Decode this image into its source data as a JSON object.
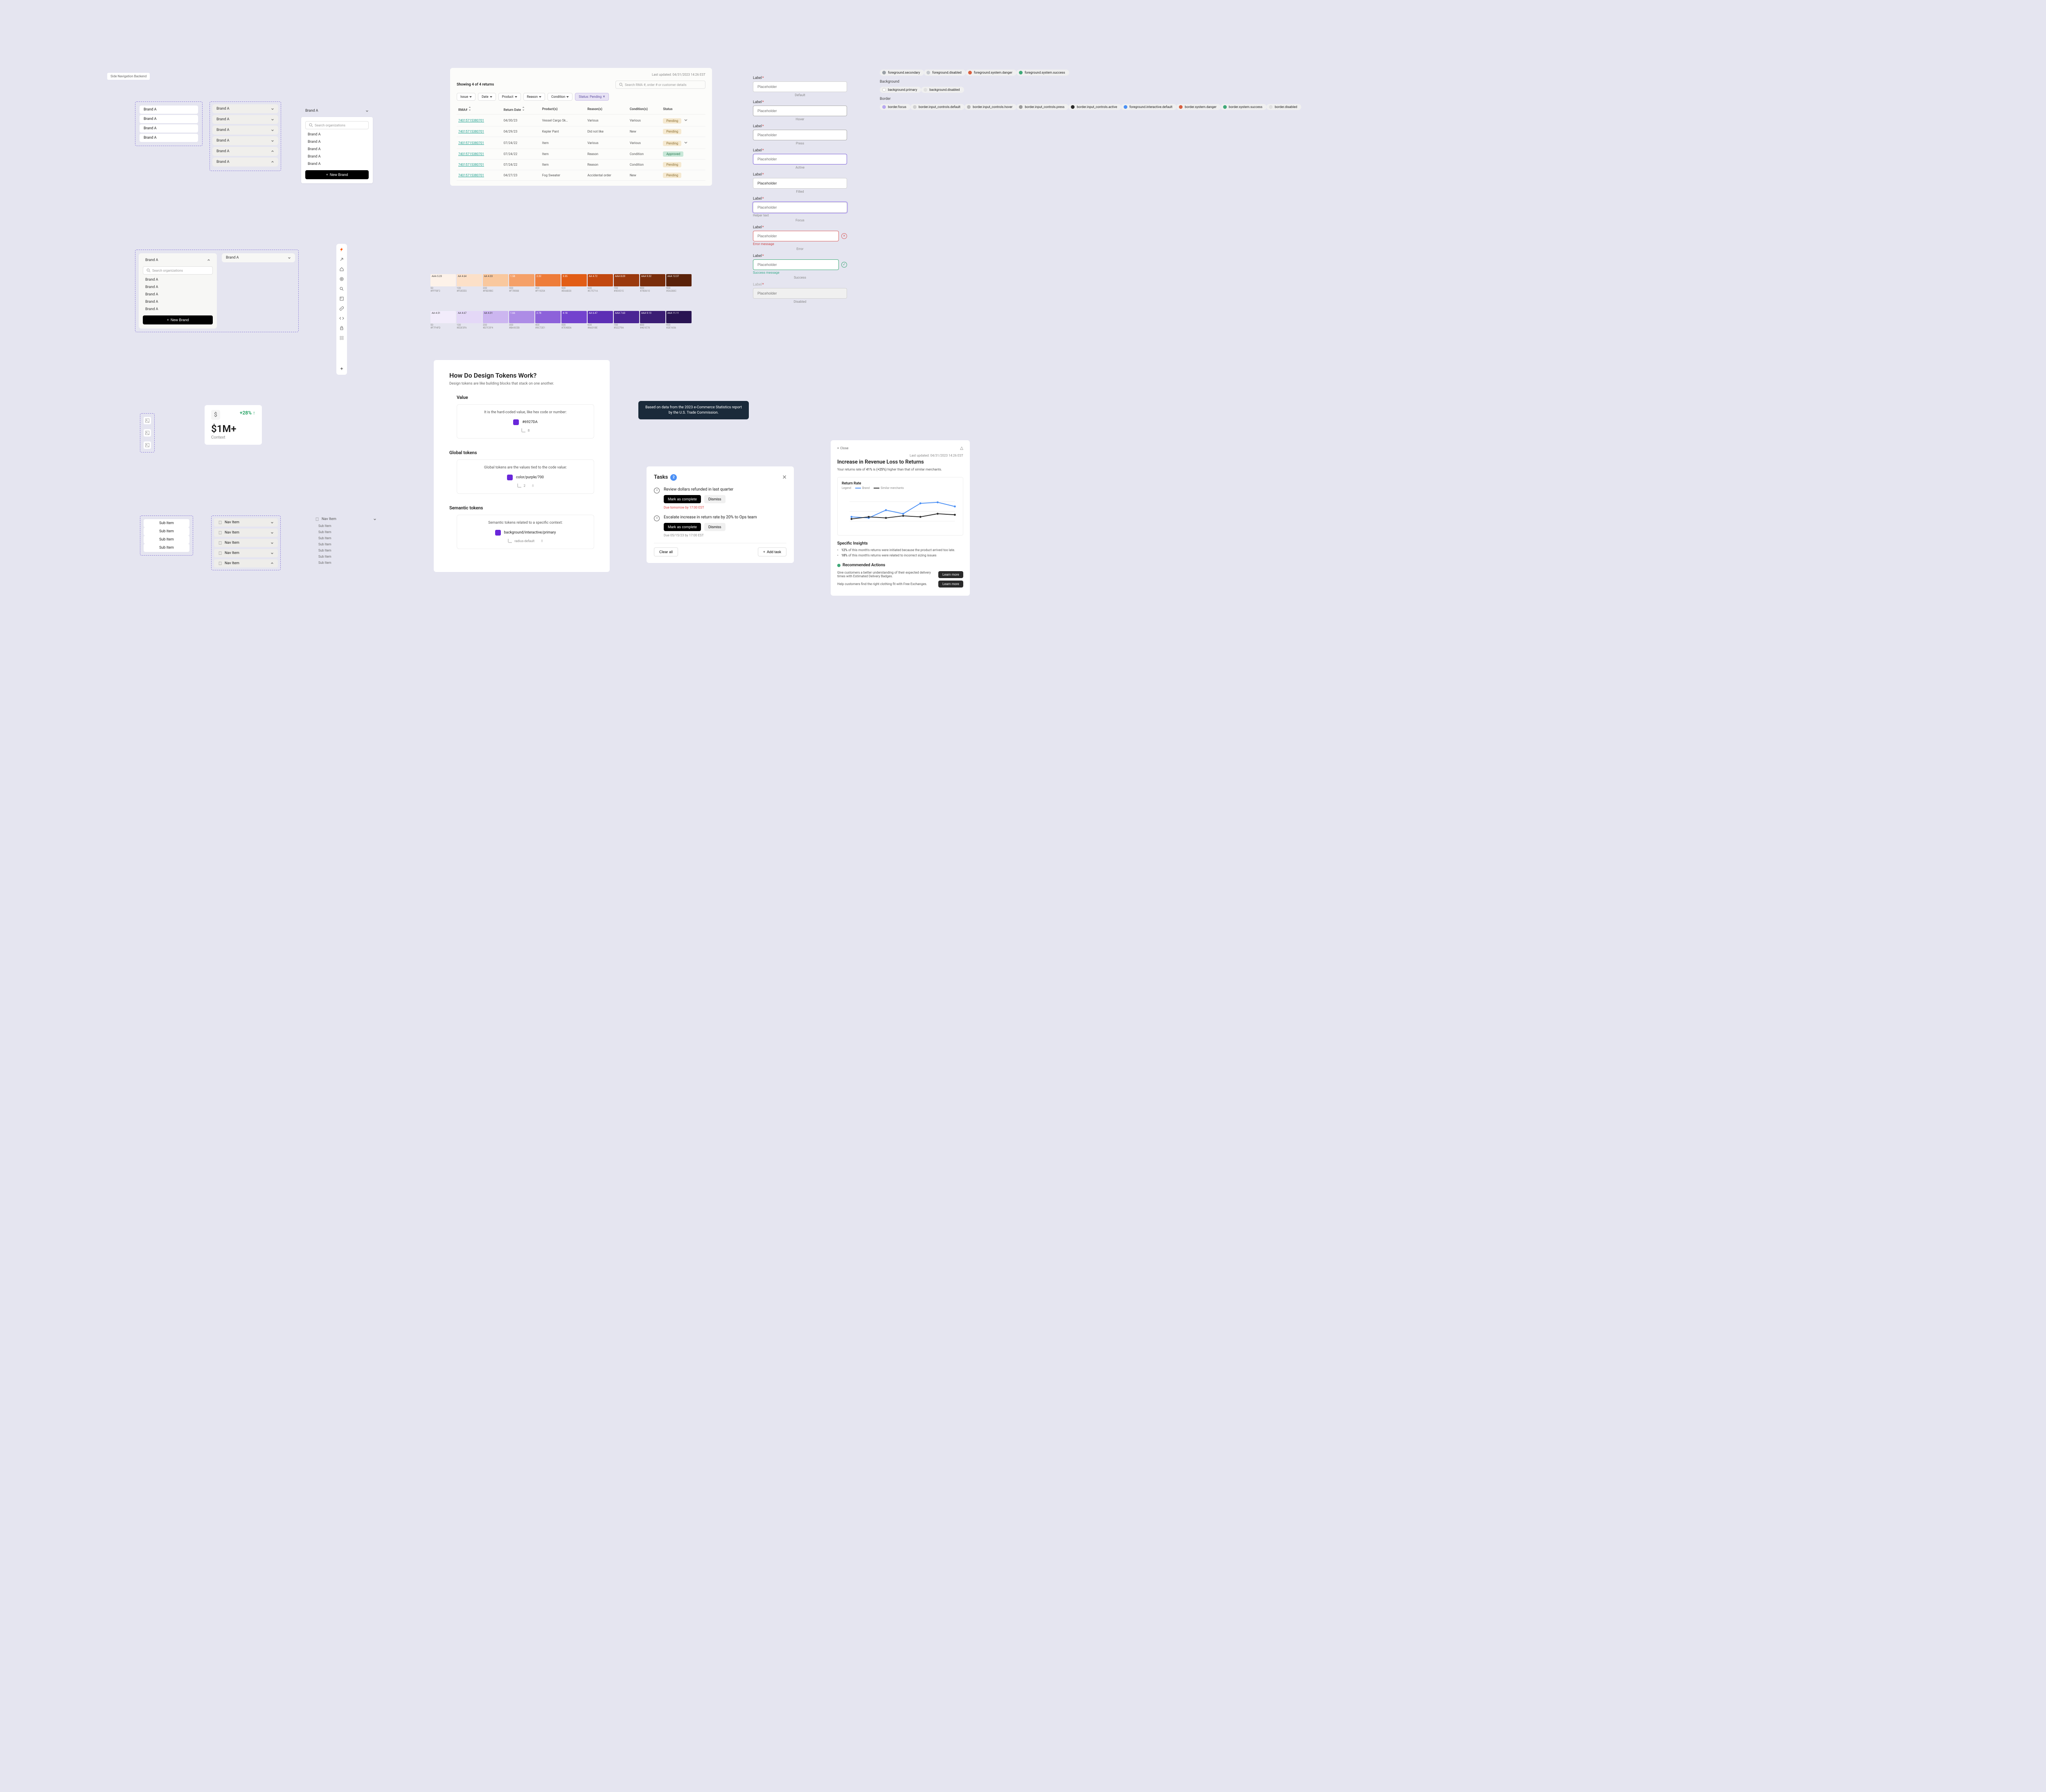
{
  "tiny_label": "Side Navigation Backend",
  "brand_box_1": {
    "items": [
      "Brand A",
      "Brand A",
      "Brand A",
      "Brand A"
    ]
  },
  "brand_box_2": {
    "items": [
      "Brand A",
      "Brand A",
      "Brand A",
      "Brand A",
      "Brand A",
      "Brand A"
    ]
  },
  "brand_box_3": {
    "header": "Brand A",
    "search_placeholder": "Search organizations",
    "items": [
      "Brand A",
      "Brand A",
      "Brand A",
      "Brand A",
      "Brand A"
    ],
    "new_brand": "New Brand"
  },
  "brand_box_4": {
    "open_header": "Brand A",
    "closed_header": "Brand A",
    "search_placeholder": "Search organizations",
    "items": [
      "Brand A",
      "Brand A",
      "Brand A",
      "Brand A",
      "Brand A"
    ],
    "new_brand": "New Brand"
  },
  "stat": {
    "pct": "+28%",
    "pct_arrow": "↑",
    "currency": "$",
    "big": "$1M+",
    "context": "Context"
  },
  "sub_items_1": {
    "items": [
      "Sub Item",
      "Sub Item",
      "Sub Item",
      "Sub Item"
    ]
  },
  "nav_items_mid": {
    "items": [
      "Nav Item",
      "Nav Item",
      "Nav Item",
      "Nav Item",
      "Nav Item"
    ]
  },
  "nav_items_right": {
    "header": "Nav Item",
    "subs": [
      "Sub Item",
      "Sub Item",
      "Sub Item",
      "Sub Item",
      "Sub Item",
      "Sub Item",
      "Sub Item"
    ]
  },
  "returns": {
    "showing": "Showing 4 of 4 returns",
    "last_updated": "Last updated: 04/31/2023 14:26 EST",
    "search_placeholder": "Search RMA #, order # or customer details",
    "filters": {
      "issue": "Issue",
      "date": "Date",
      "product": "Product",
      "reason": "Reason",
      "condition": "Condition",
      "status_active": "Status: Pending"
    },
    "headers": [
      "RMA#",
      "Return Date",
      "Product(s)",
      "Reason(s)",
      "Condition(s)",
      "Status"
    ],
    "rows": [
      {
        "rma": "74015715380701",
        "date": "04/30/23",
        "product": "Vessel Cargo Sk…",
        "reason": "Various",
        "cond": "Various",
        "status": "Pending",
        "approved": false,
        "chev": true
      },
      {
        "rma": "74015715380701",
        "date": "04/29/23",
        "product": "Kepler Pant",
        "reason": "Did not like",
        "cond": "New",
        "status": "Pending",
        "approved": false
      },
      {
        "rma": "74015715380701",
        "date": "07/24/22",
        "product": "Item",
        "reason": "Various",
        "cond": "Various",
        "status": "Pending",
        "approved": false,
        "chev": true
      },
      {
        "rma": "74015715380701",
        "date": "07/24/22",
        "product": "Item",
        "reason": "Reason",
        "cond": "Condition",
        "status": "Approved",
        "approved": true
      },
      {
        "rma": "74015715380701",
        "date": "07/24/22",
        "product": "Item",
        "reason": "Reason",
        "cond": "Condition",
        "status": "Pending",
        "approved": false
      },
      {
        "rma": "74015715380701",
        "date": "04/27/23",
        "product": "Fog Sweater",
        "reason": "Accidental order",
        "cond": "New",
        "status": "Pending",
        "approved": false
      }
    ]
  },
  "ramp_orange": {
    "swatches": [
      {
        "name": "AAA 5.23",
        "bg": "#fdf2e9",
        "fg": "#333"
      },
      {
        "name": "AA 4.64",
        "bg": "#fce0c8",
        "fg": "#333"
      },
      {
        "name": "AA 4.33",
        "bg": "#f9c89e",
        "fg": "#333"
      },
      {
        "name": "1.58",
        "bg": "#f5a068",
        "fg": "#fff"
      },
      {
        "name": "2.32",
        "bg": "#ee7c3a",
        "fg": "#fff"
      },
      {
        "name": "3.35",
        "bg": "#e25d16",
        "fg": "#fff"
      },
      {
        "name": "AA 4.72",
        "bg": "#c24810",
        "fg": "#fff"
      },
      {
        "name": "AAA 8.09",
        "bg": "#9a390e",
        "fg": "#fff"
      },
      {
        "name": "AAA 9.32",
        "bg": "#7a2e0c",
        "fg": "#fff"
      },
      {
        "name": "AAA 12.37",
        "bg": "#5a220a",
        "fg": "#fff"
      }
    ],
    "sublabels": [
      "50\n#FFF8F2",
      "100\n#FDEEE0",
      "200\n#FBD9BC",
      "300\n#F7B988",
      "400\n#F19254",
      "500\n#E66B20",
      "600\n#C7571A",
      "700\n#9E4515",
      "800\n#7B3610",
      "900\n#5A280C"
    ]
  },
  "ramp_purple": {
    "swatches": [
      {
        "name": "AA 4.51",
        "bg": "#f2ecfb",
        "fg": "#333"
      },
      {
        "name": "AA 4.67",
        "bg": "#e4d8f7",
        "fg": "#333"
      },
      {
        "name": "AA 4.31",
        "bg": "#ccb6f0",
        "fg": "#333"
      },
      {
        "name": "1.66",
        "bg": "#ad8ce6",
        "fg": "#fff"
      },
      {
        "name": "2.78",
        "bg": "#8d62da",
        "fg": "#fff"
      },
      {
        "name": "4.18",
        "bg": "#7343ce",
        "fg": "#fff"
      },
      {
        "name": "AA 6.47",
        "bg": "#5d2fb5",
        "fg": "#fff"
      },
      {
        "name": "AAA 7.63",
        "bg": "#4b2594",
        "fg": "#fff"
      },
      {
        "name": "AAA 9.13",
        "bg": "#3b1d74",
        "fg": "#fff"
      },
      {
        "name": "AAA 11.11",
        "bg": "#291452",
        "fg": "#fff"
      }
    ],
    "sublabels": [
      "50\n#F7F4FD",
      "100\n#EDE5FA",
      "200\n#D7C5F4",
      "300\n#BA9CEB",
      "400\n#9C72E1",
      "500\n#7E48D6",
      "600\n#6631BE",
      "700\n#52279A",
      "800\n#401E78",
      "900\n#2E1656"
    ]
  },
  "tokens": {
    "title": "How Do Design Tokens Work?",
    "subtitle": "Design tokens are like building blocks that stack on one another.",
    "value": {
      "h": "Value",
      "desc": "It is the hard-coded value, like hex code or number:",
      "hex": "#6927DA",
      "num": "8"
    },
    "global": {
      "h": "Global tokens",
      "desc": "Global tokens are the values tied to the code value:",
      "name": "color/purple/700",
      "step": "2",
      "sub": "8"
    },
    "semantic": {
      "h": "Semantic tokens",
      "desc": "Semantic tokens related to a specific context:",
      "name": "background/interactive/primary",
      "sub": "radius-default",
      "subnum": "8"
    }
  },
  "tooltip": "Based on data from the 2023 e-Commerce Statistics report by the U.S. Trade Commission.",
  "inputs": {
    "label": "Label",
    "req": "*",
    "ph": "Placeholder",
    "states": [
      "Default",
      "Hover",
      "Press",
      "Active",
      "Filled",
      "Focus",
      "Error",
      "Success",
      "Disabled"
    ],
    "helper": "Helper text",
    "error_msg": "Error message",
    "success_msg": "Success message"
  },
  "chips": {
    "foreground": [
      {
        "c": "#9aa0a6",
        "t": "foreground.secondary"
      },
      {
        "c": "#c4c7cc",
        "t": "foreground.disabled"
      },
      {
        "c": "#d85f3f",
        "t": "foreground.system.danger"
      },
      {
        "c": "#3fa878",
        "t": "foreground.system.success"
      }
    ],
    "background_h": "Background",
    "background": [
      {
        "c": "#ffffff",
        "t": "background.primary",
        "border": true
      },
      {
        "c": "#e0e0e0",
        "t": "background.disabled"
      }
    ],
    "border_h": "Border",
    "border": [
      {
        "c": "#b8a8f0",
        "t": "border.focus"
      },
      {
        "c": "#d0d0d0",
        "t": "border.input_controls.default"
      },
      {
        "c": "#b8b8b8",
        "t": "border.input_controls.hover"
      },
      {
        "c": "#9a9a9a",
        "t": "border.input_controls.press"
      },
      {
        "c": "#2a2a2a",
        "t": "border.input_controls.active"
      },
      {
        "c": "#4a8ff5",
        "t": "foreground.interactive.default"
      },
      {
        "c": "#d85f3f",
        "t": "border.system.danger"
      },
      {
        "c": "#3fa878",
        "t": "border.system.success"
      },
      {
        "c": "#e0e0e0",
        "t": "border.disabled"
      }
    ]
  },
  "tasks": {
    "title": "Tasks",
    "count": "2",
    "close": "×",
    "items": [
      {
        "title": "Review dollars refunded in last quarter",
        "complete": "Mark as complete",
        "dismiss": "Dismiss",
        "due": "Due tomorrow by 17:00 EST",
        "due_red": true
      },
      {
        "title": "Escalate increase in return rate by 20% to Ops team",
        "complete": "Mark as complete",
        "dismiss": "Dismiss",
        "due": "Due 05/15/23 by 17:00 EST",
        "due_red": false
      }
    ],
    "clear": "Clear all",
    "add": "Add task"
  },
  "insight": {
    "close": "Close",
    "updated": "Last updated: 04/31/2023 14:26 EST",
    "title": "Increase in Revenue Loss to Returns",
    "sub_pre": "Your returns rate of",
    "sub_bold": "41%",
    "sub_mid": "is",
    "sub_bold2": "(+25%)",
    "sub_post": "higher than that of similar merchants.",
    "chart_title": "Return Rate",
    "legend_label": "Legend",
    "legend_brand": "Brand",
    "legend_sim": "Similar merchants",
    "specific_h": "Specific Insights",
    "specifics": [
      {
        "bold": "12%",
        "text": "of this month's returns were initiated because the product arrived too late."
      },
      {
        "bold": "18%",
        "text": "of this month's returns were related to incorrect sizing issues"
      }
    ],
    "rec_h": "Recommended Actions",
    "recs": [
      {
        "text": "Give customers a better understanding of their expected delivery times with Estimated Delivery Badges.",
        "btn": "Learn more"
      },
      {
        "text": "Help customers find the right clothing fit with Free Exchanges.",
        "btn": "Learn more"
      }
    ]
  },
  "chart_data": {
    "type": "line",
    "title": "Return Rate",
    "x_ticks": [
      "",
      "",
      "",
      "",
      "",
      "",
      ""
    ],
    "y_ticks": [
      "",
      "",
      ""
    ],
    "series": [
      {
        "name": "Brand",
        "color": "#4a8ff5",
        "values": [
          22,
          20,
          35,
          28,
          48,
          50,
          42
        ]
      },
      {
        "name": "Similar merchants",
        "color": "#2a2a2a",
        "values": [
          18,
          22,
          20,
          24,
          22,
          28,
          26
        ]
      }
    ],
    "xlabel": "",
    "ylabel": "",
    "ylim": [
      10,
      55
    ]
  }
}
